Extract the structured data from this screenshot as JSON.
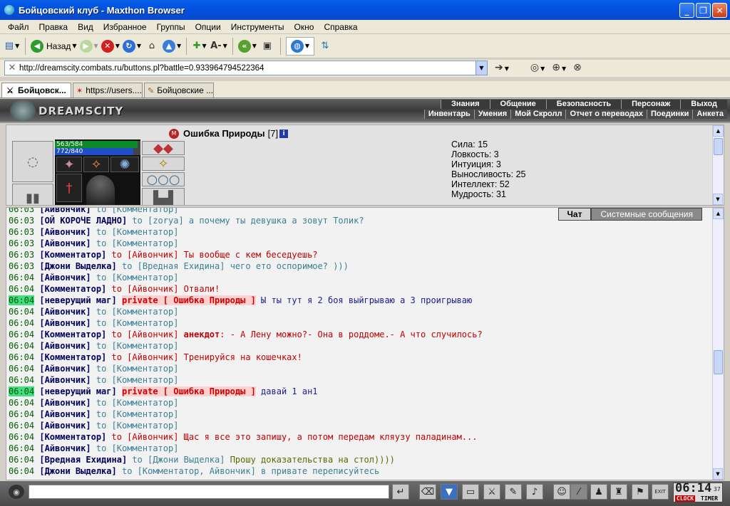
{
  "window": {
    "title": "Бойцовский клуб - Maxthon Browser"
  },
  "menu": [
    "Файл",
    "Правка",
    "Вид",
    "Избранное",
    "Группы",
    "Опции",
    "Инструменты",
    "Окно",
    "Справка"
  ],
  "toolbar": {
    "back_label": "Назад"
  },
  "address": {
    "url": "http://dreamscity.combats.ru/buttons.pl?battle=0.933964794522364"
  },
  "tabs": [
    {
      "label": "Бойцовск...",
      "icon": "crossed-swords-icon"
    },
    {
      "label": "https://users....",
      "icon": "star-icon"
    },
    {
      "label": "Бойцовские ...",
      "icon": "feather-icon"
    }
  ],
  "header": {
    "logo": "DREAMSCITY",
    "nav_top": [
      "Знания",
      "Общение",
      "Безопасность",
      "Персонаж",
      "Выход"
    ],
    "nav_sub": [
      "Инвентарь",
      "Умения",
      "Мой Скролл",
      "Отчет о переводах",
      "Поединки",
      "Анкета"
    ]
  },
  "character": {
    "name": "Ошибка Природы",
    "level": "[7]",
    "clan_badge": "M",
    "info_badge": "i",
    "hp_text": "563/584",
    "hp_fraction": 0.964,
    "mp_text": "772/840",
    "mp_fraction": 0.919,
    "stats": [
      "Сила: 15",
      "Ловкость: 3",
      "Интуиция: 3",
      "Выносливость: 25",
      "Интеллект: 52",
      "Мудрость: 31"
    ]
  },
  "chat": {
    "tabs": [
      "Чат",
      "Системные сообщения"
    ],
    "lines": [
      {
        "time": "06:03",
        "from": "[Айвончик]",
        "to": "to [Комментатор]",
        "msg": "",
        "style": ""
      },
      {
        "time": "06:03",
        "from": "[ОЙ КОРОЧЕ ЛАДНО]",
        "to": "to [zorya]",
        "msg": "а почему ты девушка а зовут Толик?",
        "style": ""
      },
      {
        "time": "06:03",
        "from": "[Айвончик]",
        "to": "to [Комментатор]",
        "msg": "",
        "style": ""
      },
      {
        "time": "06:03",
        "from": "[Айвончик]",
        "to": "to [Комментатор]",
        "msg": "",
        "style": ""
      },
      {
        "time": "06:03",
        "from": "[Комментатор]",
        "to": "to [Айвончик]",
        "msg": "Ты вообще с кем беседуешь?",
        "style": "red"
      },
      {
        "time": "06:03",
        "from": "[Джони Выделка]",
        "to": "to [Вредная Ехидина]",
        "msg": "чего ето оспоримое? )))",
        "style": ""
      },
      {
        "time": "06:04",
        "from": "[Айвончик]",
        "to": "to [Комментатор]",
        "msg": "",
        "style": ""
      },
      {
        "time": "06:04",
        "from": "[Комментатор]",
        "to": "to [Айвончик]",
        "msg": "Отвали!",
        "style": "red"
      },
      {
        "time": "06:04",
        "from": "[неверущий маг]",
        "private": "private [ Ошибка Природы ]",
        "msg": "Ы ты тут я 2 боя выйгрываю а 3 проигрываю",
        "style": "blue",
        "highlight": true
      },
      {
        "time": "06:04",
        "from": "[Айвончик]",
        "to": "to [Комментатор]",
        "msg": "",
        "style": ""
      },
      {
        "time": "06:04",
        "from": "[Айвончик]",
        "to": "to [Комментатор]",
        "msg": "",
        "style": ""
      },
      {
        "time": "06:04",
        "from": "[Комментатор]",
        "to": "to [Айвончик]",
        "anekdot": "анекдот",
        "msg": ": - А Лену можно?- Она в роддоме.- А что случилось?",
        "style": "red"
      },
      {
        "time": "06:04",
        "from": "[Айвончик]",
        "to": "to [Комментатор]",
        "msg": "",
        "style": ""
      },
      {
        "time": "06:04",
        "from": "[Комментатор]",
        "to": "to [Айвончик]",
        "msg": "Тренируйся на кошечках!",
        "style": "red"
      },
      {
        "time": "06:04",
        "from": "[Айвончик]",
        "to": "to [Комментатор]",
        "msg": "",
        "style": ""
      },
      {
        "time": "06:04",
        "from": "[Айвончик]",
        "to": "to [Комментатор]",
        "msg": "",
        "style": ""
      },
      {
        "time": "06:04",
        "from": "[неверущий маг]",
        "private": "private [ Ошибка Природы ]",
        "msg": "давай 1 ан1",
        "style": "blue",
        "highlight": true
      },
      {
        "time": "06:04",
        "from": "[Айвончик]",
        "to": "to [Комментатор]",
        "msg": "",
        "style": ""
      },
      {
        "time": "06:04",
        "from": "[Айвончик]",
        "to": "to [Комментатор]",
        "msg": "",
        "style": ""
      },
      {
        "time": "06:04",
        "from": "[Айвончик]",
        "to": "to [Комментатор]",
        "msg": "",
        "style": ""
      },
      {
        "time": "06:04",
        "from": "[Комментатор]",
        "to": "to [Айвончик]",
        "msg": "Щас я все это запишу, а потом передам кляузу паладинам...",
        "style": "red"
      },
      {
        "time": "06:04",
        "from": "[Айвончик]",
        "to": "to [Комментатор]",
        "msg": "",
        "style": ""
      },
      {
        "time": "06:04",
        "from": "[Вредная Ехидина]",
        "to": "to [Джони Выделка]",
        "msg": "Прошу доказательства на стол))))",
        "style": "olive"
      },
      {
        "time": "06:04",
        "from": "[Джони Выделка]",
        "to": "to [Комментатор, Айвончик]",
        "msg": "в привате переписуйтесь",
        "style": ""
      }
    ]
  },
  "clock": {
    "time": "06:14",
    "seconds": "37",
    "clock_label": "CLOCK",
    "timer_label": "TIMER"
  },
  "exit_label": "EXIT"
}
